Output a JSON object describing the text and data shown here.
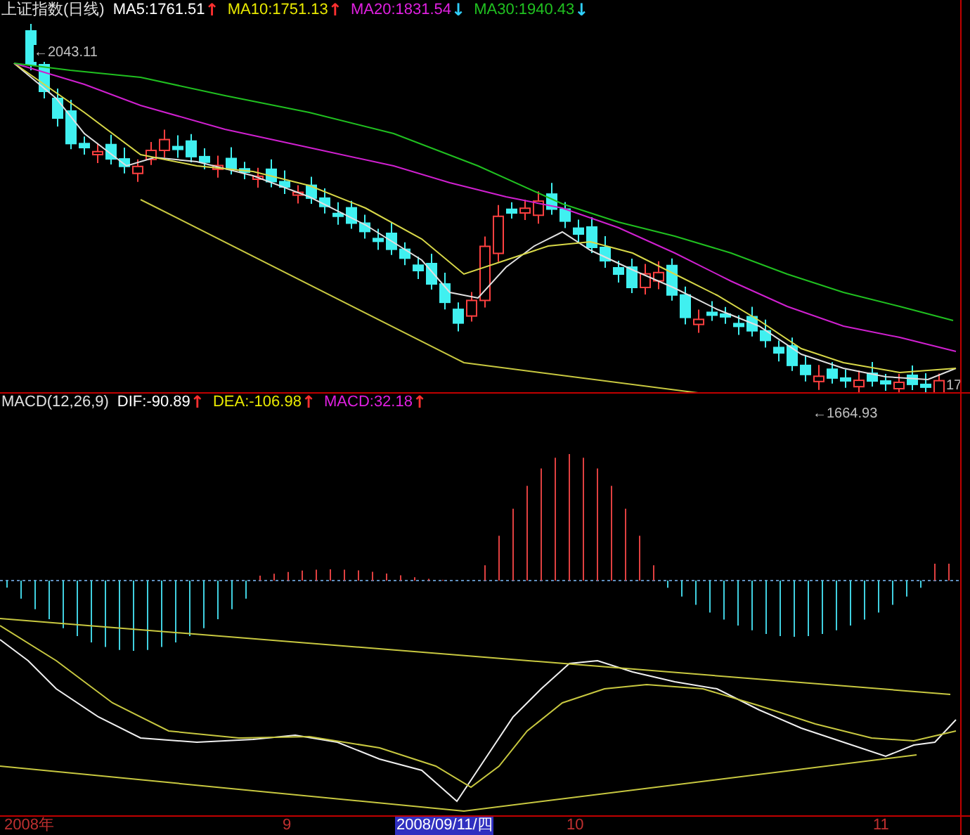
{
  "header": {
    "title": "上证指数(日线)",
    "indicators": [
      {
        "label": "MA5:1761.51",
        "arrow": {
          "text": "↑",
          "color": "#ff3030"
        },
        "color": "#ffffff"
      },
      {
        "label": "MA10:1751.13",
        "arrow": {
          "text": "↑",
          "color": "#ff3030"
        },
        "color": "#e8e800"
      },
      {
        "label": "MA20:1831.54",
        "arrow": {
          "text": "↓",
          "color": "#30d0ff"
        },
        "color": "#e020e0"
      },
      {
        "label": "MA30:1940.43",
        "arrow": {
          "text": "↓",
          "color": "#30d0ff"
        },
        "color": "#20c020"
      }
    ]
  },
  "price_chart": {
    "high_label": "←2043.11",
    "low_label": "←1664.93",
    "edge_label": "17"
  },
  "macd": {
    "title": "MACD(12,26,9)",
    "indicators": [
      {
        "label": "DIF:-90.89",
        "arrow": {
          "text": "↑",
          "color": "#ff3030"
        },
        "color": "#ffffff"
      },
      {
        "label": "DEA:-106.98",
        "arrow": {
          "text": "↑",
          "color": "#ff3030"
        },
        "color": "#e8e800"
      },
      {
        "label": "MACD:32.18",
        "arrow": {
          "text": "↑",
          "color": "#ff3030"
        },
        "color": "#e020e0"
      }
    ]
  },
  "time_axis": {
    "labels": [
      {
        "text": "2008年",
        "selected": false
      },
      {
        "text": "9",
        "selected": false
      },
      {
        "text": "2008/09/11/四",
        "selected": true
      },
      {
        "text": "10",
        "selected": false
      },
      {
        "text": "11",
        "selected": false
      }
    ]
  }
}
